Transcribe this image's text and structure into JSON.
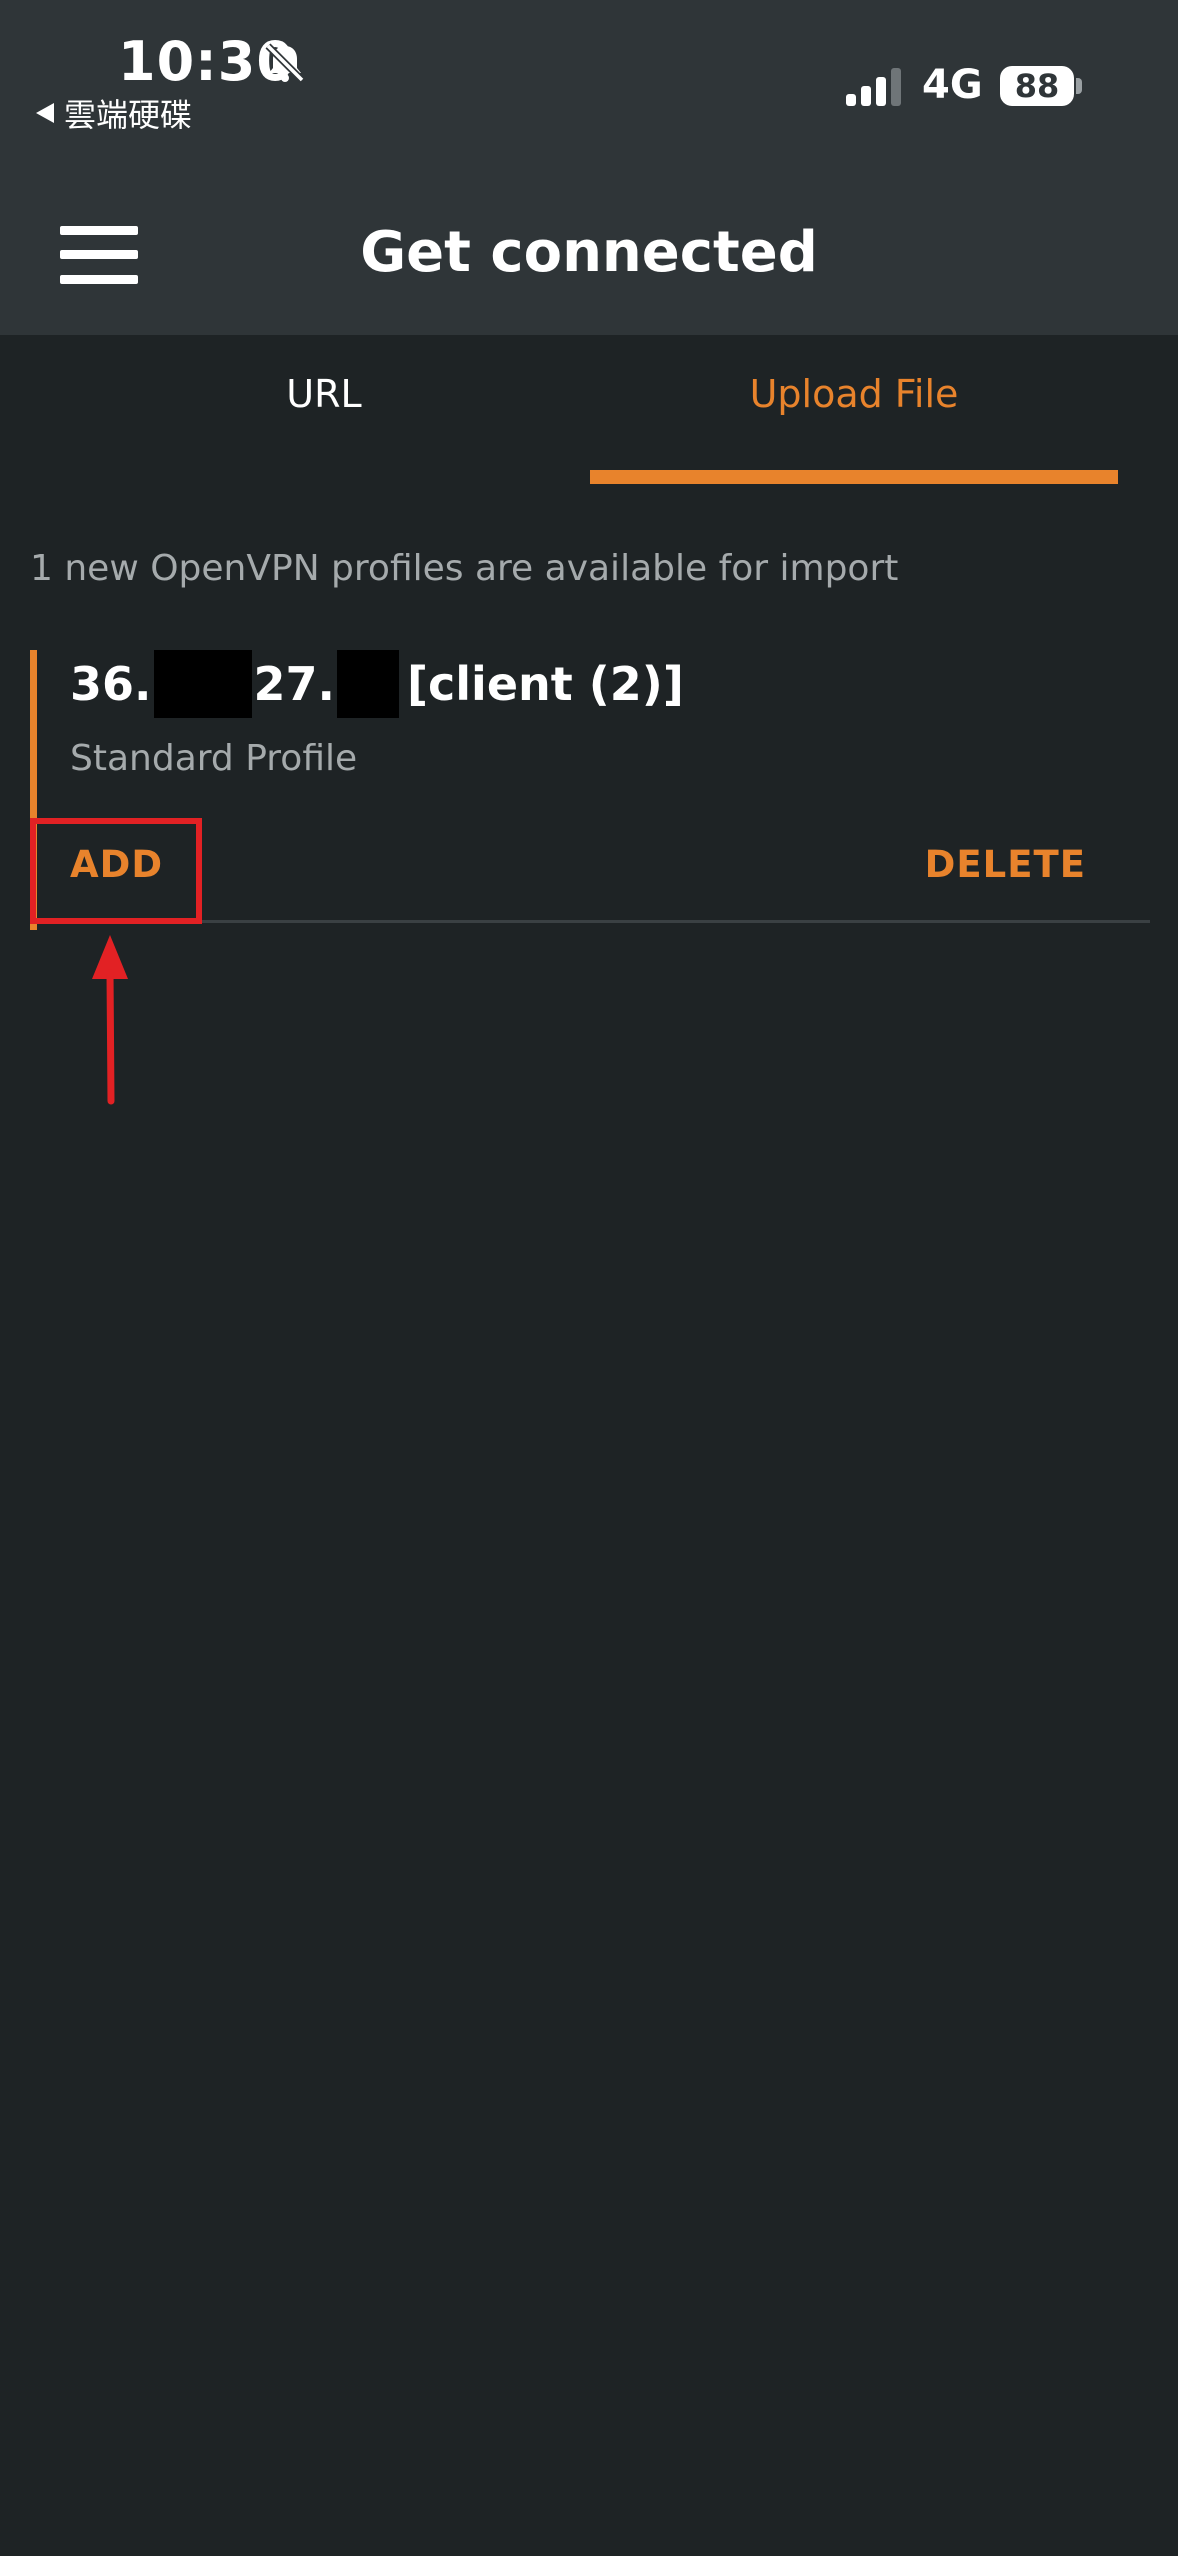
{
  "status_bar": {
    "time": "10:30",
    "back_app": "雲端硬碟",
    "network": "4G",
    "battery": "88"
  },
  "header": {
    "title": "Get connected"
  },
  "tabs": [
    {
      "label": "URL",
      "active": false
    },
    {
      "label": "Upload File",
      "active": true
    }
  ],
  "import_info": "1 new OpenVPN profiles are available for import",
  "profile": {
    "title_part1": "36.",
    "title_part2": "27.",
    "title_part3": "[client (2)]",
    "subtitle": "Standard Profile",
    "add_label": "ADD",
    "delete_label": "DELETE"
  },
  "colors": {
    "accent": "#e8832c",
    "background": "#1e2325",
    "header_background": "#2f3538",
    "annotation": "#e22124"
  },
  "icons": {
    "bell": "bell-slash-icon",
    "signal": "cellular-signal-icon",
    "menu": "hamburger-menu-icon"
  }
}
